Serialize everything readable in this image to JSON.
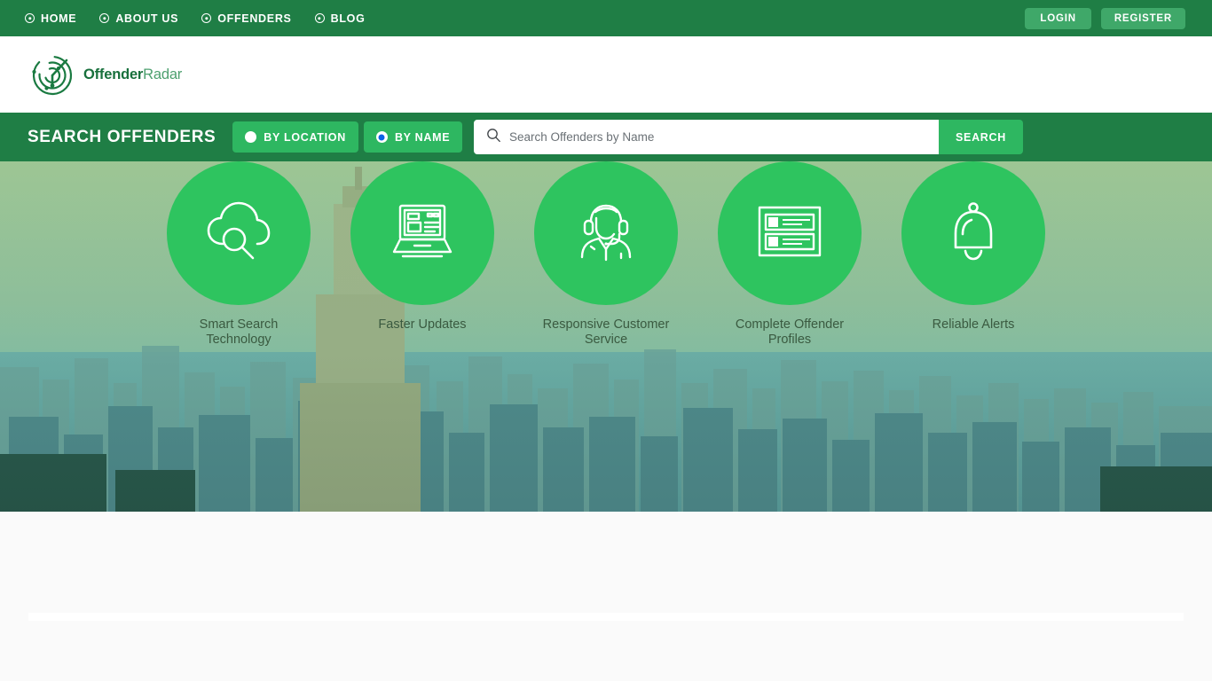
{
  "theme": {
    "dark_green": "#1f7e45",
    "mid_green": "#2eb761",
    "circle_green": "#2ec45f",
    "button_green": "#3fa869",
    "radio_blue": "#0b63e5",
    "label_green": "#3a5a40"
  },
  "topnav": {
    "items": [
      {
        "label": "HOME",
        "icon": "bullseye-icon"
      },
      {
        "label": "ABOUT US",
        "icon": "bullseye-icon"
      },
      {
        "label": "OFFENDERS",
        "icon": "bullseye-icon"
      },
      {
        "label": "BLOG",
        "icon": "bullseye-icon"
      }
    ],
    "login_label": "LOGIN",
    "register_label": "REGISTER"
  },
  "brand": {
    "name_bold": "Offender",
    "name_light": "Radar",
    "logo_icon": "radar-logo-icon"
  },
  "search": {
    "title": "SEARCH OFFENDERS",
    "modes": [
      {
        "label": "BY LOCATION",
        "selected": false
      },
      {
        "label": "BY NAME",
        "selected": true
      }
    ],
    "placeholder": "Search Offenders by Name",
    "value": "",
    "submit_label": "SEARCH",
    "search_icon": "magnifier-icon"
  },
  "hero": {
    "image_description": "New York City skyline aerial view with green tint overlay"
  },
  "features": [
    {
      "label": "Smart Search Technology",
      "icon": "cloud-search-icon"
    },
    {
      "label": "Faster Updates",
      "icon": "laptop-icon"
    },
    {
      "label": "Responsive Customer Service",
      "icon": "headset-support-icon"
    },
    {
      "label": "Complete Offender Profiles",
      "icon": "id-card-list-icon"
    },
    {
      "label": "Reliable Alerts",
      "icon": "bell-icon"
    }
  ]
}
